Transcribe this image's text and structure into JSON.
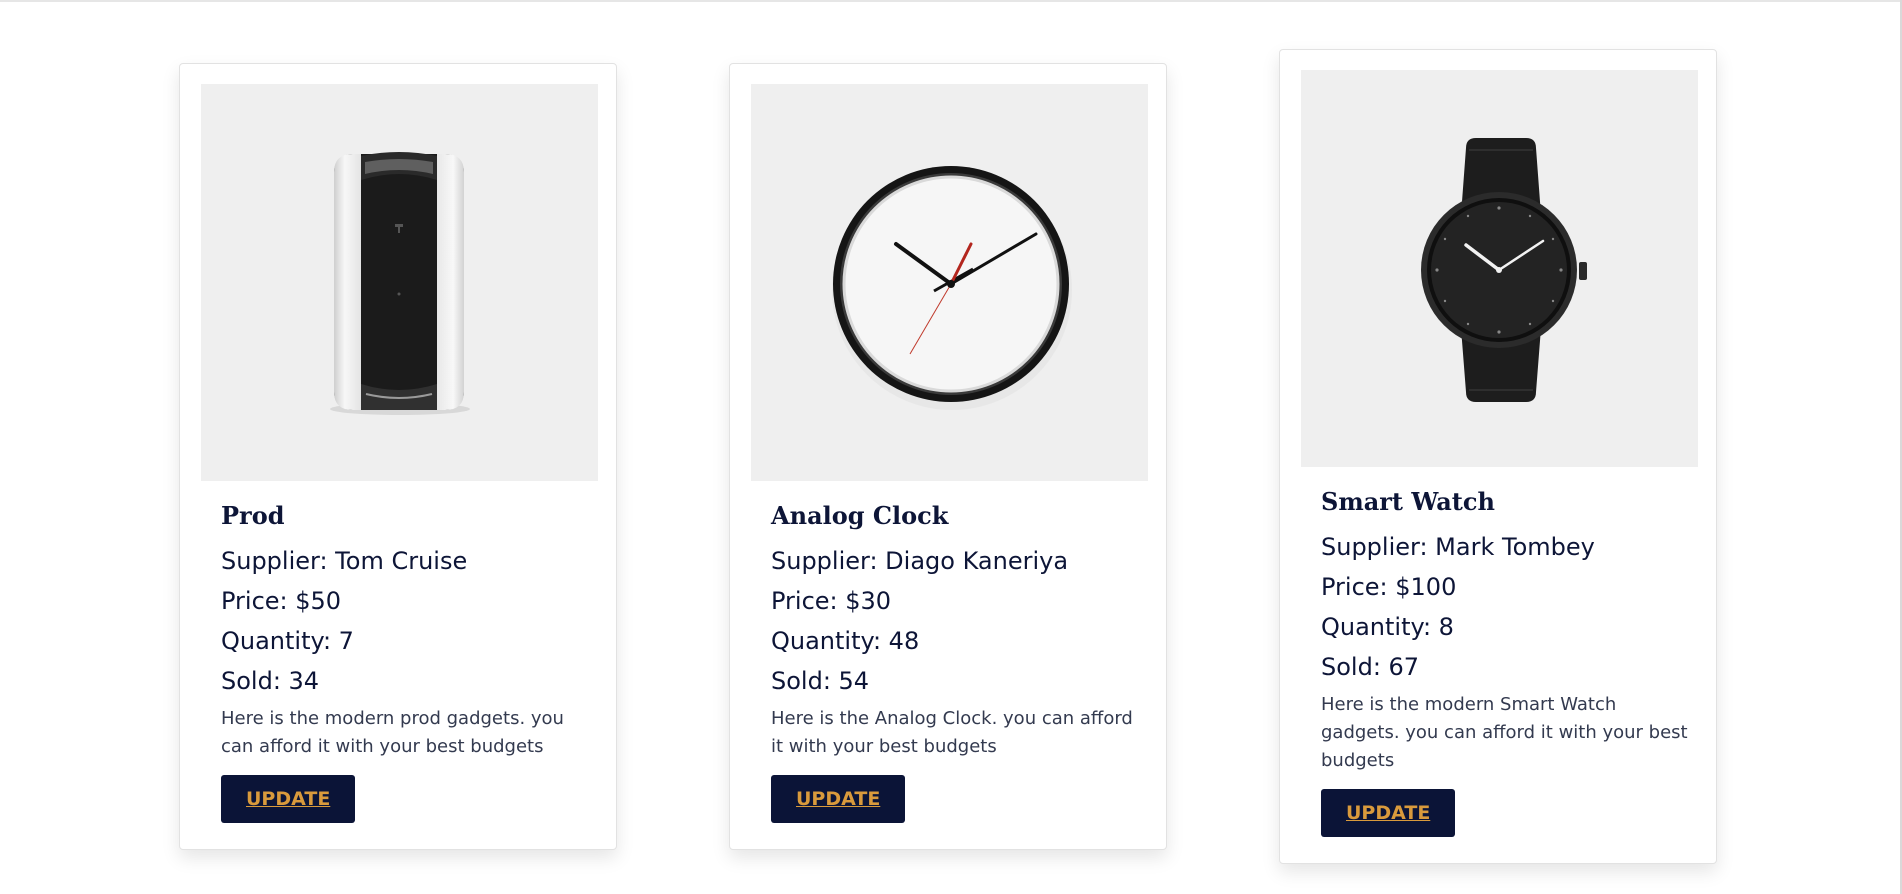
{
  "products": [
    {
      "name": "Prod",
      "supplier": "Supplier: Tom Cruise",
      "price": "Price: $50",
      "quantity": "Quantity: 7",
      "sold": "Sold: 34",
      "description": "Here is the modern prod gadgets. you can afford it with your best budgets",
      "button": "UPDATE",
      "image": "home-security-device-image"
    },
    {
      "name": "Analog Clock",
      "supplier": "Supplier: Diago Kaneriya",
      "price": "Price: $30",
      "quantity": "Quantity: 48",
      "sold": "Sold: 54",
      "description": "Here is the Analog Clock. you can afford it with your best budgets",
      "button": "UPDATE",
      "image": "analog-clock-image"
    },
    {
      "name": "Smart Watch",
      "supplier": "Supplier: Mark Tombey",
      "price": "Price: $100",
      "quantity": "Quantity: 8",
      "sold": "Sold: 67",
      "description": "Here is the modern Smart Watch gadgets. you can afford it with your best budgets",
      "button": "UPDATE",
      "image": "smart-watch-image"
    }
  ],
  "colors": {
    "button_bg": "#0b1437",
    "button_text": "#d99a3c",
    "text_primary": "#0d1537",
    "image_bg": "#efefef"
  }
}
